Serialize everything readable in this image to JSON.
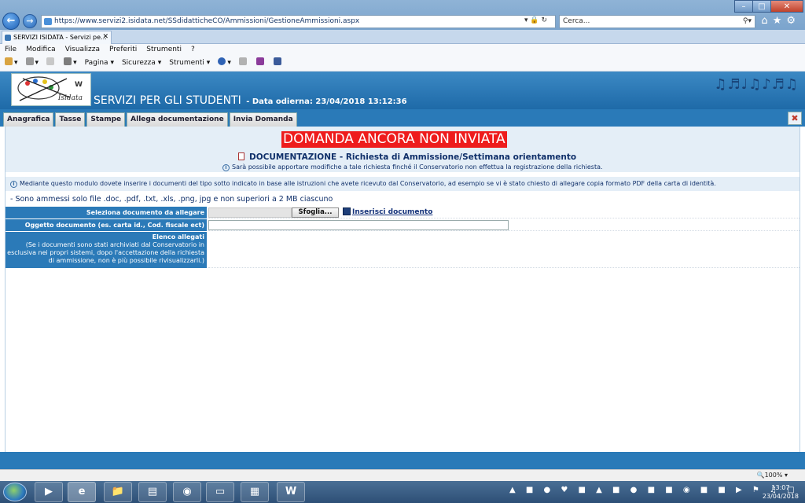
{
  "browser": {
    "url": "https://www.servizi2.isidata.net/SSdidatticheCO/Ammissioni/GestioneAmmissioni.aspx",
    "search_placeholder": "Cerca...",
    "tab_title": "SERVIZI ISIDATA - Servizi pe...",
    "menu": [
      "File",
      "Modifica",
      "Visualizza",
      "Preferiti",
      "Strumenti",
      "?"
    ],
    "commands": [
      "Pagina",
      "Sicurezza",
      "Strumenti"
    ],
    "zoom": "100%"
  },
  "header": {
    "logo_text": "Isidata",
    "title": "SERVIZI PER GLI STUDENTI",
    "date_label": "- Data odierna: 23/04/2018 13:12:36"
  },
  "page_tabs": [
    "Anagrafica",
    "Tasse",
    "Stampe",
    "Allega documentazione",
    "Invia Domanda"
  ],
  "status": {
    "warning": "DOMANDA ANCORA NON INVIATA",
    "doc_title": "DOCUMENTAZIONE - Richiesta di Ammissione/Settimana orientamento",
    "doc_note": "Sarà possibile apportare modifiche a tale richiesta finché il Conservatorio non effettua la registrazione della richiesta."
  },
  "intro": "Mediante questo modulo dovete inserire i documenti del tipo sotto indicato in base alle istruzioni che avete ricevuto dal Conservatorio, ad esempio se vi è stato chiesto di allegare copia formato PDF della carta di identità.",
  "allowed": "- Sono ammessi solo file .doc, .pdf, .txt, .xls, .png, jpg e non superiori a 2 MB ciascuno",
  "form": {
    "select_label": "Seleziona documento da allegare",
    "browse_label": "Sfoglia...",
    "insert_label": "Inserisci documento",
    "subject_label": "Oggetto documento (es. carta id., Cod. fiscale ect)",
    "subject_value": "",
    "list_label": "Elenco allegati",
    "list_note": "(Se i documenti sono stati archiviati dal Conservatorio in esclusiva nei propri sistemi, dopo l'accettazione della richiesta di ammissione, non è più possibile rivisualizzarli.)"
  },
  "taskbar": {
    "time": "13:07",
    "date": "23/04/2018"
  }
}
